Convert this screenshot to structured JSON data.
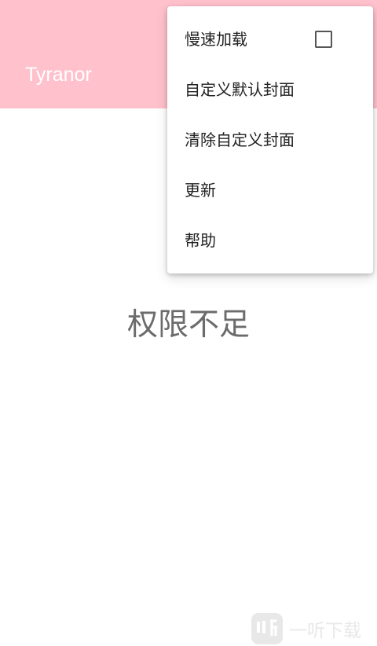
{
  "app_bar": {
    "title": "Tyranor",
    "background_color": "#ffc1cc"
  },
  "menu": {
    "items": [
      {
        "label": "慢速加载",
        "has_checkbox": true,
        "checked": false
      },
      {
        "label": "自定义默认封面"
      },
      {
        "label": "清除自定义封面"
      },
      {
        "label": "更新"
      },
      {
        "label": "帮助"
      }
    ]
  },
  "content": {
    "message": "权限不足"
  },
  "watermark": {
    "text": "一听下载",
    "icon": "yiting-logo-icon"
  }
}
